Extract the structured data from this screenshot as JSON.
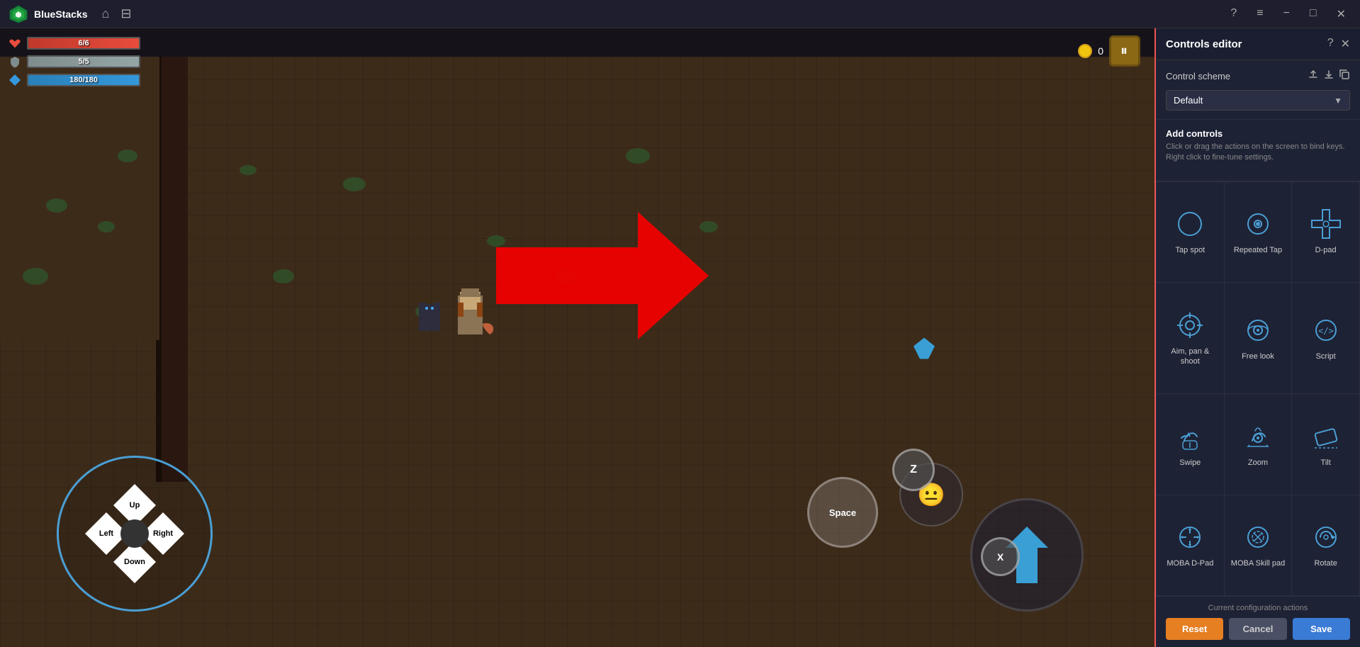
{
  "app": {
    "name": "BlueStacks",
    "title_bar": {
      "help_icon": "?",
      "menu_icon": "≡",
      "minimize_icon": "−",
      "maximize_icon": "□",
      "close_icon": "✕"
    }
  },
  "game": {
    "hud": {
      "health": {
        "current": 6,
        "max": 6,
        "display": "6/6"
      },
      "mana": {
        "current": 5,
        "max": 5,
        "display": "5/5"
      },
      "stamina": {
        "current": 180,
        "max": 180,
        "display": "180/180"
      },
      "coins": "0"
    },
    "dpad": {
      "up_label": "Up",
      "down_label": "Down",
      "left_label": "Left",
      "right_label": "Right"
    },
    "buttons": {
      "space_label": "Space",
      "z_label": "Z",
      "x_label": "X"
    }
  },
  "controls_panel": {
    "title": "Controls editor",
    "help_icon": "?",
    "close_icon": "✕",
    "control_scheme": {
      "label": "Control scheme",
      "upload_icon": "↑",
      "download_icon": "↓",
      "copy_icon": "⊡",
      "current_value": "Default"
    },
    "add_controls": {
      "title": "Add controls",
      "description": "Click or drag the actions on the screen to bind keys. Right click to fine-tune settings."
    },
    "controls": [
      {
        "id": "tap-spot",
        "label": "Tap spot",
        "icon_type": "circle"
      },
      {
        "id": "repeated-tap",
        "label": "Repeated\nTap",
        "icon_type": "circle-dots"
      },
      {
        "id": "d-pad",
        "label": "D-pad",
        "icon_type": "dpad"
      },
      {
        "id": "aim-pan-shoot",
        "label": "Aim, pan &\nshoot",
        "icon_type": "crosshair"
      },
      {
        "id": "free-look",
        "label": "Free look",
        "icon_type": "eye-circle"
      },
      {
        "id": "script",
        "label": "Script",
        "icon_type": "code"
      },
      {
        "id": "swipe",
        "label": "Swipe",
        "icon_type": "swipe"
      },
      {
        "id": "zoom",
        "label": "Zoom",
        "icon_type": "zoom"
      },
      {
        "id": "tilt",
        "label": "Tilt",
        "icon_type": "tilt"
      },
      {
        "id": "moba-dpad",
        "label": "MOBA D-Pad",
        "icon_type": "moba-dpad"
      },
      {
        "id": "moba-skill-pad",
        "label": "MOBA Skill pad",
        "icon_type": "moba-skill"
      },
      {
        "id": "rotate",
        "label": "Rotate",
        "icon_type": "rotate"
      }
    ],
    "footer": {
      "config_text": "Current configuration actions",
      "reset_label": "Reset",
      "cancel_label": "Cancel",
      "save_label": "Save"
    }
  }
}
